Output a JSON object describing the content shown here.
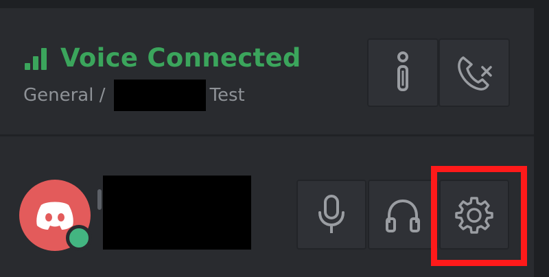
{
  "voice_panel": {
    "title": "Voice Connected",
    "channel_prefix": "General /",
    "channel_suffix": "Test",
    "signal_icon": "signal-bars-icon",
    "info_icon": "info-icon",
    "hangup_icon": "phone-hangup-icon"
  },
  "user_panel": {
    "avatar_icon": "discord-logo-icon",
    "status": "online",
    "mic_icon": "microphone-icon",
    "headset_icon": "headphones-icon",
    "settings_icon": "gear-icon"
  },
  "colors": {
    "accent_green": "#3ba55c",
    "status_online": "#43b581",
    "avatar_bg": "#e35b5b",
    "highlight_red": "#ff1a1a",
    "panel_bg": "#292b2f",
    "button_bg": "#2f3136"
  }
}
